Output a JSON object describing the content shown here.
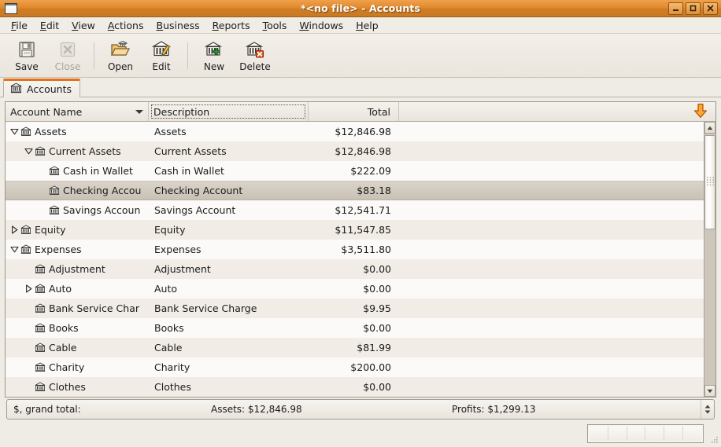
{
  "window": {
    "title": "*<no file> - Accounts",
    "app_icon": "window-icon",
    "controls": {
      "minimize": "_",
      "maximize": "□",
      "close": "✕"
    }
  },
  "menubar": {
    "items": [
      {
        "label": "File",
        "mnemonic": "F"
      },
      {
        "label": "Edit",
        "mnemonic": "E"
      },
      {
        "label": "View",
        "mnemonic": "V"
      },
      {
        "label": "Actions",
        "mnemonic": "A"
      },
      {
        "label": "Business",
        "mnemonic": "B"
      },
      {
        "label": "Reports",
        "mnemonic": "R"
      },
      {
        "label": "Tools",
        "mnemonic": "T"
      },
      {
        "label": "Windows",
        "mnemonic": "W"
      },
      {
        "label": "Help",
        "mnemonic": "H"
      }
    ]
  },
  "toolbar": {
    "items": [
      {
        "label": "Save",
        "icon": "floppy-disk-icon",
        "disabled": false
      },
      {
        "label": "Close",
        "icon": "close-x-icon",
        "disabled": true
      },
      {
        "label": "Open",
        "icon": "open-folder-icon",
        "disabled": false
      },
      {
        "label": "Edit",
        "icon": "edit-pencil-icon",
        "disabled": false
      },
      {
        "label": "New",
        "icon": "new-account-plus-icon",
        "disabled": false
      },
      {
        "label": "Delete",
        "icon": "delete-account-x-icon",
        "disabled": false
      }
    ]
  },
  "tabs": [
    {
      "label": "Accounts",
      "icon": "bank-icon",
      "active": true
    }
  ],
  "tree": {
    "columns": [
      {
        "key": "name",
        "label": "Account Name",
        "sorted": true,
        "sort_dir": "descending-arrow"
      },
      {
        "key": "description",
        "label": "Description",
        "focused": true
      },
      {
        "key": "total",
        "label": "Total"
      }
    ],
    "column_options_icon": "orange-down-arrow-icon",
    "rows": [
      {
        "name": "Assets",
        "description": "Assets",
        "total": "$12,846.98",
        "depth": 0,
        "expander": "expanded",
        "selected": false
      },
      {
        "name": "Current Assets",
        "description": "Current Assets",
        "total": "$12,846.98",
        "depth": 1,
        "expander": "expanded",
        "selected": false
      },
      {
        "name": "Cash in Wallet",
        "description": "Cash in Wallet",
        "total": "$222.09",
        "depth": 2,
        "expander": "none",
        "selected": false
      },
      {
        "name": "Checking Accou",
        "description": "Checking Account",
        "total": "$83.18",
        "depth": 2,
        "expander": "none",
        "selected": true
      },
      {
        "name": "Savings Accoun",
        "description": "Savings Account",
        "total": "$12,541.71",
        "depth": 2,
        "expander": "none",
        "selected": false
      },
      {
        "name": "Equity",
        "description": "Equity",
        "total": "$11,547.85",
        "depth": 0,
        "expander": "collapsed",
        "selected": false
      },
      {
        "name": "Expenses",
        "description": "Expenses",
        "total": "$3,511.80",
        "depth": 0,
        "expander": "expanded",
        "selected": false
      },
      {
        "name": "Adjustment",
        "description": "Adjustment",
        "total": "$0.00",
        "depth": 1,
        "expander": "none",
        "selected": false
      },
      {
        "name": "Auto",
        "description": "Auto",
        "total": "$0.00",
        "depth": 1,
        "expander": "collapsed",
        "selected": false
      },
      {
        "name": "Bank Service Char",
        "description": "Bank Service Charge",
        "total": "$9.95",
        "depth": 1,
        "expander": "none",
        "selected": false
      },
      {
        "name": "Books",
        "description": "Books",
        "total": "$0.00",
        "depth": 1,
        "expander": "none",
        "selected": false
      },
      {
        "name": "Cable",
        "description": "Cable",
        "total": "$81.99",
        "depth": 1,
        "expander": "none",
        "selected": false
      },
      {
        "name": "Charity",
        "description": "Charity",
        "total": "$200.00",
        "depth": 1,
        "expander": "none",
        "selected": false
      },
      {
        "name": "Clothes",
        "description": "Clothes",
        "total": "$0.00",
        "depth": 1,
        "expander": "none",
        "selected": false
      }
    ]
  },
  "summary": {
    "grand_total_label": "$, grand total:",
    "assets": "Assets: $12,846.98",
    "profits": "Profits: $1,299.13"
  },
  "colors": {
    "titlebar_accent": "#e08a2e",
    "tab_accent": "#e4711b",
    "selection": "#cfc8bc",
    "arrow_orange": "#f28b1c"
  }
}
